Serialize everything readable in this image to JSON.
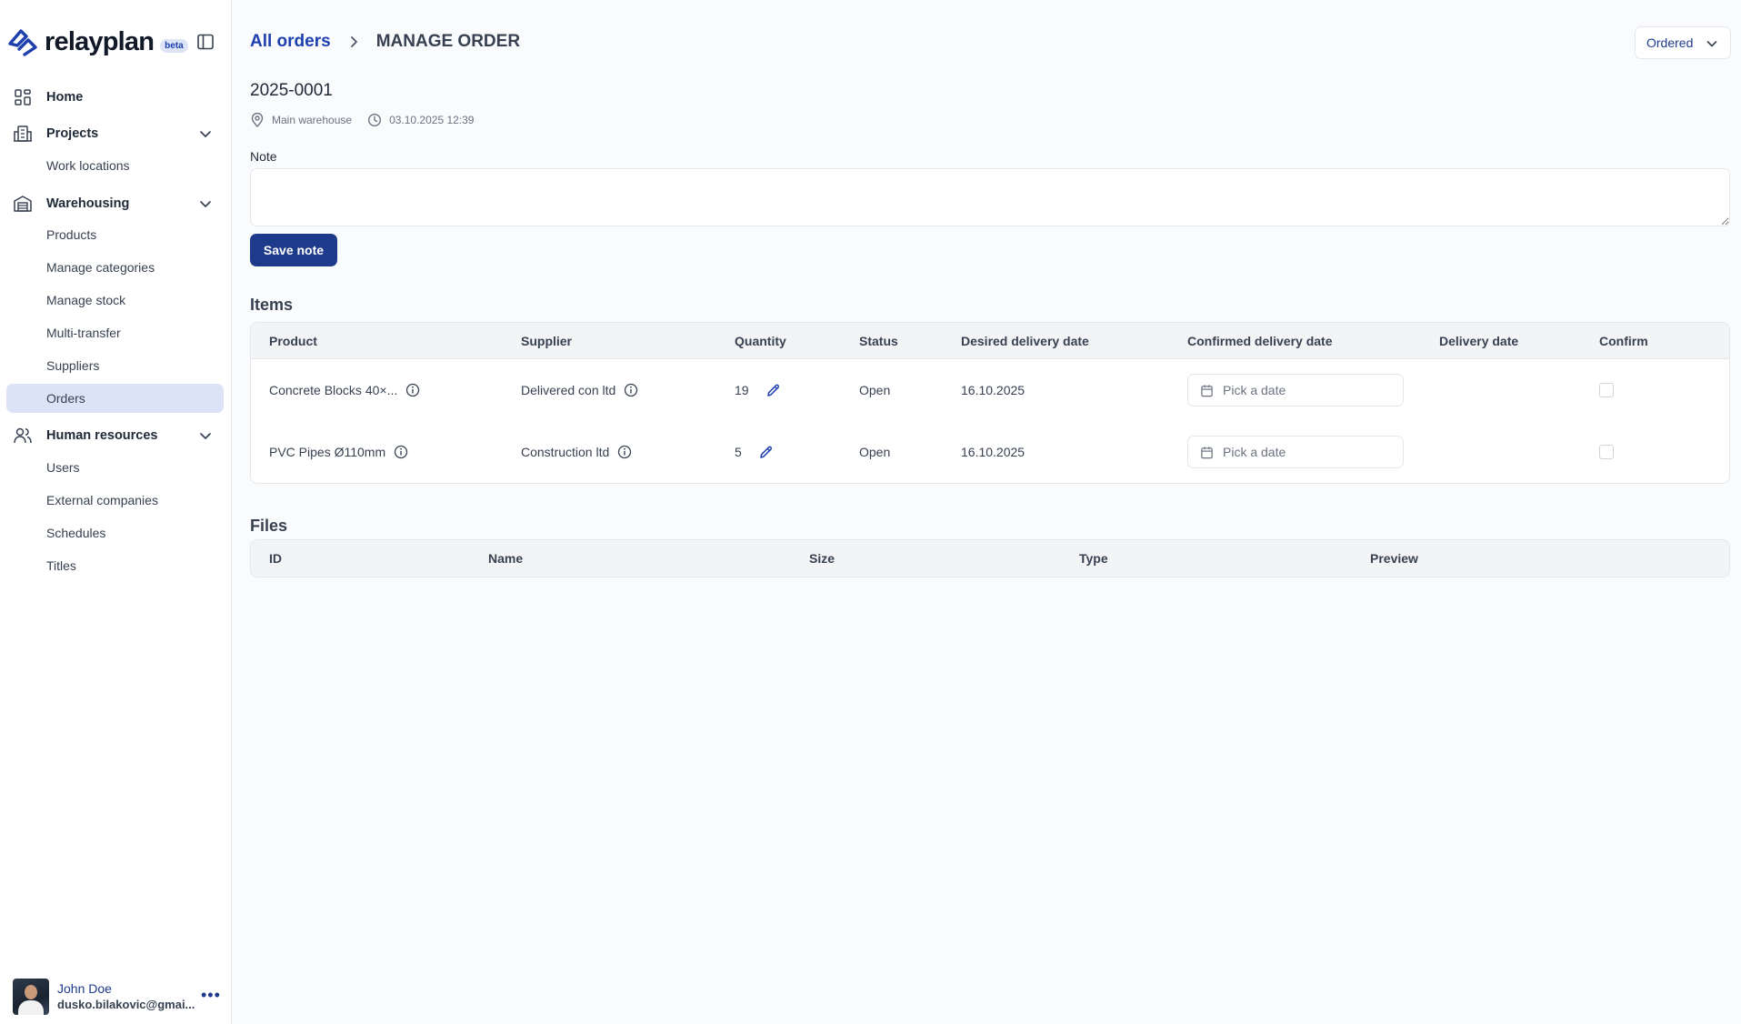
{
  "brand": {
    "name": "relayplan",
    "badge": "beta"
  },
  "nav": {
    "home": "Home",
    "projects": {
      "label": "Projects",
      "items": [
        "Work locations"
      ]
    },
    "warehousing": {
      "label": "Warehousing",
      "items": [
        "Products",
        "Manage categories",
        "Manage stock",
        "Multi-transfer",
        "Suppliers",
        "Orders"
      ]
    },
    "hr": {
      "label": "Human resources",
      "items": [
        "Users",
        "External companies",
        "Schedules",
        "Titles"
      ]
    },
    "active_item": "Orders"
  },
  "user": {
    "name": "John Doe",
    "email": "dusko.bilakovic@gmai..."
  },
  "header": {
    "breadcrumb_link": "All orders",
    "breadcrumb_current": "MANAGE ORDER",
    "status_value": "Ordered"
  },
  "order": {
    "id": "2025-0001",
    "location": "Main warehouse",
    "datetime": "03.10.2025 12:39"
  },
  "note": {
    "label": "Note",
    "value": "",
    "save_label": "Save note"
  },
  "items": {
    "title": "Items",
    "columns": [
      "Product",
      "Supplier",
      "Quantity",
      "Status",
      "Desired delivery date",
      "Confirmed delivery date",
      "Delivery date",
      "Confirm"
    ],
    "rows": [
      {
        "product": "Concrete Blocks 40×...",
        "supplier": "Delivered con ltd",
        "quantity": "19",
        "status": "Open",
        "desired": "16.10.2025",
        "confirmed_placeholder": "Pick a date",
        "delivery": "",
        "confirmed": false
      },
      {
        "product": "PVC Pipes Ø110mm",
        "supplier": "Construction ltd",
        "quantity": "5",
        "status": "Open",
        "desired": "16.10.2025",
        "confirmed_placeholder": "Pick a date",
        "delivery": "",
        "confirmed": false
      }
    ]
  },
  "files": {
    "title": "Files",
    "columns": [
      "ID",
      "Name",
      "Size",
      "Type",
      "Preview"
    ],
    "rows": []
  },
  "colors": {
    "accent": "#1e3a8a",
    "link": "#1e40af",
    "active_nav_bg": "#dce3f7"
  }
}
